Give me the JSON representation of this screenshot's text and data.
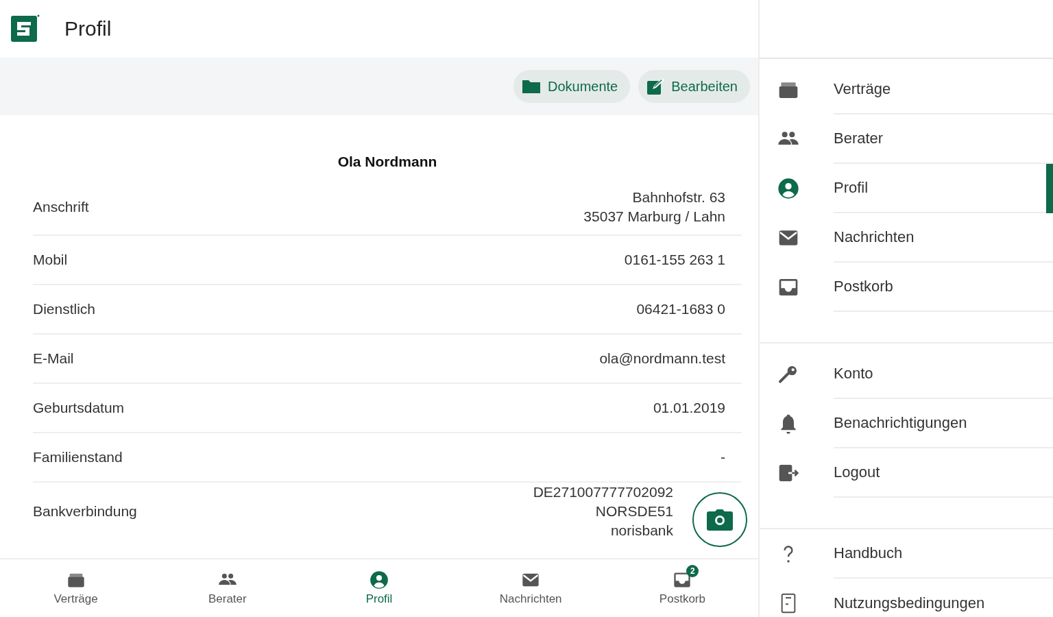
{
  "header": {
    "title": "Profil"
  },
  "toolbar": {
    "buttons": [
      "Dokumente",
      "Bearbeiten"
    ]
  },
  "profile": {
    "name": "Ola Nordmann",
    "rows": [
      {
        "label": "Anschrift",
        "lines": [
          "Bahnhofstr. 63",
          "35037 Marburg / Lahn"
        ]
      },
      {
        "label": "Mobil",
        "lines": [
          "0161-155 263 1"
        ]
      },
      {
        "label": "Dienstlich",
        "lines": [
          "06421-1683 0"
        ]
      },
      {
        "label": "E-Mail",
        "lines": [
          "ola@nordmann.test"
        ]
      },
      {
        "label": "Geburtsdatum",
        "lines": [
          "01.01.2019"
        ]
      },
      {
        "label": "Familienstand",
        "lines": [
          "-"
        ]
      },
      {
        "label": "Bankverbindung",
        "lines": [
          "DE271007777702092",
          "NORSDE51",
          "norisbank"
        ]
      }
    ]
  },
  "bottom_nav": [
    {
      "label": "Verträge",
      "selected": false
    },
    {
      "label": "Berater",
      "selected": false
    },
    {
      "label": "Profil",
      "selected": true
    },
    {
      "label": "Nachrichten",
      "selected": false
    },
    {
      "label": "Postkorb",
      "selected": false,
      "badge": "2"
    }
  ],
  "drawer": {
    "groups": [
      [
        {
          "label": "Verträge",
          "selected": false
        },
        {
          "label": "Berater",
          "selected": false
        },
        {
          "label": "Profil",
          "selected": true
        },
        {
          "label": "Nachrichten",
          "selected": false
        },
        {
          "label": "Postkorb",
          "selected": false
        }
      ],
      [
        {
          "label": "Konto",
          "selected": false
        },
        {
          "label": "Benachrichtigungen",
          "selected": false
        },
        {
          "label": "Logout",
          "selected": false
        }
      ],
      [
        {
          "label": "Handbuch",
          "selected": false
        },
        {
          "label": "Nutzungsbedingungen",
          "selected": false
        }
      ]
    ]
  }
}
